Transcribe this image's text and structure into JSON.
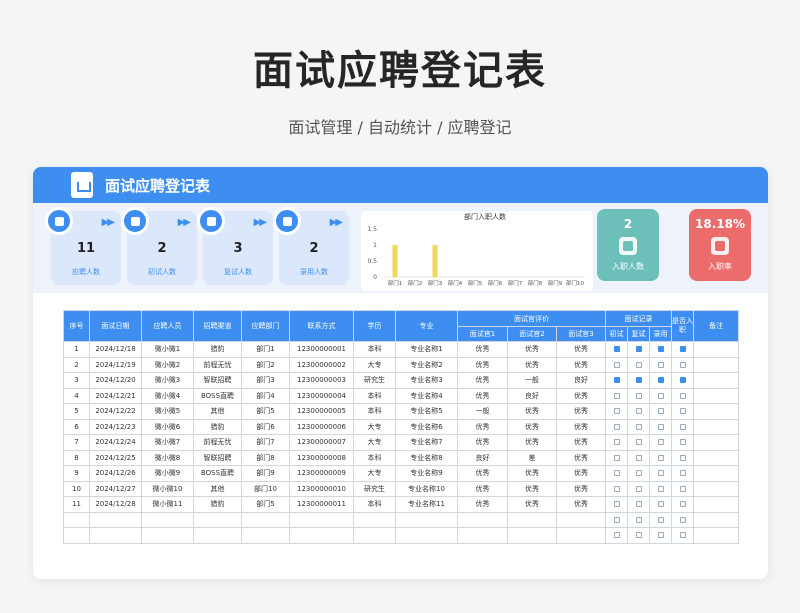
{
  "hero": {
    "title": "面试应聘登记表",
    "subtitle": "面试管理 / 自动统计 / 应聘登记"
  },
  "header": {
    "title": "面试应聘登记表"
  },
  "stats": [
    {
      "value": "11",
      "label": "应聘人数"
    },
    {
      "value": "2",
      "label": "初试人数"
    },
    {
      "value": "3",
      "label": "复试人数"
    },
    {
      "value": "2",
      "label": "录用人数"
    }
  ],
  "kpis": [
    {
      "value": "2",
      "label": "入职人数"
    },
    {
      "value": "18.18%",
      "label": "入职率"
    }
  ],
  "chart_data": {
    "type": "bar",
    "title": "部门入职人数",
    "categories": [
      "部门1",
      "部门2",
      "部门3",
      "部门4",
      "部门5",
      "部门6",
      "部门7",
      "部门8",
      "部门9",
      "部门10"
    ],
    "values": [
      1,
      0,
      1,
      0,
      0,
      0,
      0,
      0,
      0,
      0
    ],
    "ylim": [
      0,
      1.5
    ],
    "yticks": [
      "0",
      "0.5",
      "1",
      "1.5"
    ],
    "color": "#f0d65a"
  },
  "table": {
    "headers": [
      "序号",
      "面试日期",
      "应聘人员",
      "招聘渠道",
      "应聘部门",
      "联系方式",
      "学历",
      "专业"
    ],
    "eval_group": "面试官评价",
    "eval_headers": [
      "面试官1",
      "面试官2",
      "面试官3"
    ],
    "record_group": "面试记录",
    "record_headers": [
      "初试",
      "复试",
      "录用"
    ],
    "joined_header": "是否入职",
    "remark_header": "备注",
    "rows": [
      {
        "no": "1",
        "date": "2024/12/18",
        "name": "微小微1",
        "channel": "猎豹",
        "dept": "部门1",
        "phone": "12300000001",
        "edu": "本科",
        "major": "专业名称1",
        "e1": "优秀",
        "e2": "优秀",
        "e3": "优秀",
        "c1": true,
        "c2": true,
        "c3": true,
        "j": true
      },
      {
        "no": "2",
        "date": "2024/12/19",
        "name": "微小微2",
        "channel": "前程无忧",
        "dept": "部门2",
        "phone": "12300000002",
        "edu": "大专",
        "major": "专业名称2",
        "e1": "优秀",
        "e2": "优秀",
        "e3": "优秀",
        "c1": false,
        "c2": false,
        "c3": false,
        "j": false
      },
      {
        "no": "3",
        "date": "2024/12/20",
        "name": "微小微3",
        "channel": "智联招聘",
        "dept": "部门3",
        "phone": "12300000003",
        "edu": "研究生",
        "major": "专业名称3",
        "e1": "优秀",
        "e2": "一般",
        "e3": "良好",
        "c1": true,
        "c2": true,
        "c3": true,
        "j": true
      },
      {
        "no": "4",
        "date": "2024/12/21",
        "name": "微小微4",
        "channel": "BOSS直聘",
        "dept": "部门4",
        "phone": "12300000004",
        "edu": "本科",
        "major": "专业名称4",
        "e1": "优秀",
        "e2": "良好",
        "e3": "优秀",
        "c1": false,
        "c2": false,
        "c3": false,
        "j": false
      },
      {
        "no": "5",
        "date": "2024/12/22",
        "name": "微小微5",
        "channel": "其他",
        "dept": "部门5",
        "phone": "12300000005",
        "edu": "本科",
        "major": "专业名称5",
        "e1": "一般",
        "e2": "优秀",
        "e3": "优秀",
        "c1": false,
        "c2": false,
        "c3": false,
        "j": false
      },
      {
        "no": "6",
        "date": "2024/12/23",
        "name": "微小微6",
        "channel": "猎豹",
        "dept": "部门6",
        "phone": "12300000006",
        "edu": "大专",
        "major": "专业名称6",
        "e1": "优秀",
        "e2": "优秀",
        "e3": "优秀",
        "c1": false,
        "c2": false,
        "c3": false,
        "j": false
      },
      {
        "no": "7",
        "date": "2024/12/24",
        "name": "微小微7",
        "channel": "前程无忧",
        "dept": "部门7",
        "phone": "12300000007",
        "edu": "大专",
        "major": "专业名称7",
        "e1": "优秀",
        "e2": "优秀",
        "e3": "优秀",
        "c1": false,
        "c2": false,
        "c3": false,
        "j": false
      },
      {
        "no": "8",
        "date": "2024/12/25",
        "name": "微小微8",
        "channel": "智联招聘",
        "dept": "部门8",
        "phone": "12300000008",
        "edu": "本科",
        "major": "专业名称8",
        "e1": "良好",
        "e2": "差",
        "e3": "优秀",
        "c1": false,
        "c2": false,
        "c3": false,
        "j": false
      },
      {
        "no": "9",
        "date": "2024/12/26",
        "name": "微小微9",
        "channel": "BOSS直聘",
        "dept": "部门9",
        "phone": "12300000009",
        "edu": "大专",
        "major": "专业名称9",
        "e1": "优秀",
        "e2": "优秀",
        "e3": "优秀",
        "c1": false,
        "c2": false,
        "c3": false,
        "j": false
      },
      {
        "no": "10",
        "date": "2024/12/27",
        "name": "微小微10",
        "channel": "其他",
        "dept": "部门10",
        "phone": "12300000010",
        "edu": "研究生",
        "major": "专业名称10",
        "e1": "优秀",
        "e2": "优秀",
        "e3": "优秀",
        "c1": false,
        "c2": false,
        "c3": false,
        "j": false
      },
      {
        "no": "11",
        "date": "2024/12/28",
        "name": "微小微11",
        "channel": "猎豹",
        "dept": "部门5",
        "phone": "12300000011",
        "edu": "本科",
        "major": "专业名称11",
        "e1": "优秀",
        "e2": "优秀",
        "e3": "优秀",
        "c1": false,
        "c2": false,
        "c3": false,
        "j": false
      },
      {
        "no": "",
        "date": "",
        "name": "",
        "channel": "",
        "dept": "",
        "phone": "",
        "edu": "",
        "major": "",
        "e1": "",
        "e2": "",
        "e3": "",
        "c1": false,
        "c2": false,
        "c3": false,
        "j": false
      },
      {
        "no": "",
        "date": "",
        "name": "",
        "channel": "",
        "dept": "",
        "phone": "",
        "edu": "",
        "major": "",
        "e1": "",
        "e2": "",
        "e3": "",
        "c1": false,
        "c2": false,
        "c3": false,
        "j": false
      }
    ]
  }
}
